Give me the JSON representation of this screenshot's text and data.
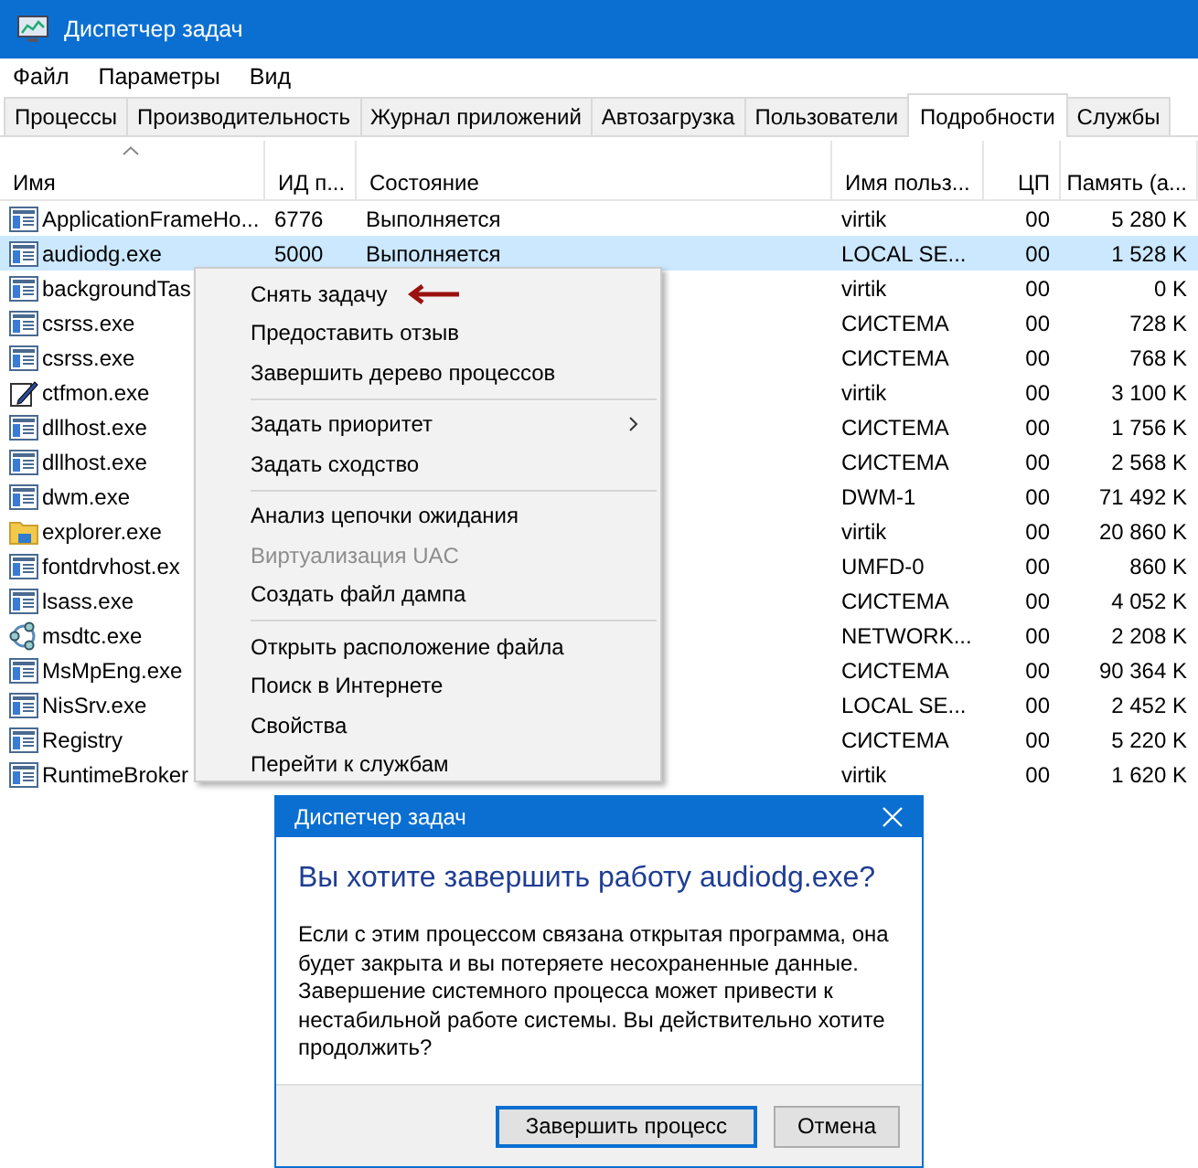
{
  "window": {
    "title": "Диспетчер задач"
  },
  "menu_bar": [
    "Файл",
    "Параметры",
    "Вид"
  ],
  "tabs": [
    {
      "label": "Процессы",
      "selected": false
    },
    {
      "label": "Производительность",
      "selected": false
    },
    {
      "label": "Журнал приложений",
      "selected": false
    },
    {
      "label": "Автозагрузка",
      "selected": false
    },
    {
      "label": "Пользователи",
      "selected": false
    },
    {
      "label": "Подробности",
      "selected": true
    },
    {
      "label": "Службы",
      "selected": false
    }
  ],
  "table": {
    "columns": [
      {
        "label": "Имя",
        "sorted": true
      },
      {
        "label": "ИД п...",
        "sorted": false
      },
      {
        "label": "Состояние",
        "sorted": false
      },
      {
        "label": "Имя польз...",
        "sorted": false
      },
      {
        "label": "ЦП",
        "sorted": false
      },
      {
        "label": "Память (а...",
        "sorted": false
      }
    ],
    "rows": [
      {
        "kind": "window",
        "name": "ApplicationFrameHo...",
        "pid": "6776",
        "state": "Выполняется",
        "user": "virtik",
        "cpu": "00",
        "memory": "5 280 K",
        "selected": false
      },
      {
        "kind": "window",
        "name": "audiodg.exe",
        "pid": "5000",
        "state": "Выполняется",
        "user": "LOCAL SE...",
        "cpu": "00",
        "memory": "1 528 K",
        "selected": true
      },
      {
        "kind": "window",
        "name": "backgroundTas",
        "user": "virtik",
        "cpu": "00",
        "memory": "0 K",
        "selected": false
      },
      {
        "kind": "window",
        "name": "csrss.exe",
        "user": "СИСТЕМА",
        "cpu": "00",
        "memory": "728 K",
        "selected": false
      },
      {
        "kind": "window",
        "name": "csrss.exe",
        "user": "СИСТЕМА",
        "cpu": "00",
        "memory": "768 K",
        "selected": false
      },
      {
        "kind": "pen",
        "name": "ctfmon.exe",
        "user": "virtik",
        "cpu": "00",
        "memory": "3 100 K",
        "selected": false
      },
      {
        "kind": "window",
        "name": "dllhost.exe",
        "user": "СИСТЕМА",
        "cpu": "00",
        "memory": "1 756 K",
        "selected": false
      },
      {
        "kind": "window",
        "name": "dllhost.exe",
        "user": "СИСТЕМА",
        "cpu": "00",
        "memory": "2 568 K",
        "selected": false
      },
      {
        "kind": "window",
        "name": "dwm.exe",
        "user": "DWM-1",
        "cpu": "00",
        "memory": "71 492 K",
        "selected": false
      },
      {
        "kind": "folder",
        "name": "explorer.exe",
        "user": "virtik",
        "cpu": "00",
        "memory": "20 860 K",
        "selected": false
      },
      {
        "kind": "window",
        "name": "fontdrvhost.ex",
        "user": "UMFD-0",
        "cpu": "00",
        "memory": "860 K",
        "selected": false
      },
      {
        "kind": "window",
        "name": "lsass.exe",
        "user": "СИСТЕМА",
        "cpu": "00",
        "memory": "4 052 K",
        "selected": false
      },
      {
        "kind": "network",
        "name": "msdtc.exe",
        "user": "NETWORK...",
        "cpu": "00",
        "memory": "2 208 K",
        "selected": false
      },
      {
        "kind": "window",
        "name": "MsMpEng.exe",
        "user": "СИСТЕМА",
        "cpu": "00",
        "memory": "90 364 K",
        "selected": false
      },
      {
        "kind": "window",
        "name": "NisSrv.exe",
        "user": "LOCAL SE...",
        "cpu": "00",
        "memory": "2 452 K",
        "selected": false
      },
      {
        "kind": "window",
        "name": "Registry",
        "user": "СИСТЕМА",
        "cpu": "00",
        "memory": "5 220 K",
        "selected": false
      },
      {
        "kind": "window",
        "name": "RuntimeBroker",
        "user": "virtik",
        "cpu": "00",
        "memory": "1 620 K",
        "selected": false
      }
    ]
  },
  "context_menu": {
    "items": [
      {
        "kind": "item",
        "label": "Снять задачу",
        "disabled": false,
        "submenu": false,
        "annotated": true
      },
      {
        "kind": "item",
        "label": "Предоставить отзыв",
        "disabled": false,
        "submenu": false,
        "annotated": false
      },
      {
        "kind": "item",
        "label": "Завершить дерево процессов",
        "disabled": false,
        "submenu": false,
        "annotated": false
      },
      {
        "kind": "separator"
      },
      {
        "kind": "item",
        "label": "Задать приоритет",
        "disabled": false,
        "submenu": true,
        "annotated": false
      },
      {
        "kind": "item",
        "label": "Задать сходство",
        "disabled": false,
        "submenu": false,
        "annotated": false
      },
      {
        "kind": "separator"
      },
      {
        "kind": "item",
        "label": "Анализ цепочки ожидания",
        "disabled": false,
        "submenu": false,
        "annotated": false
      },
      {
        "kind": "item",
        "label": "Виртуализация UAC",
        "disabled": true,
        "submenu": false,
        "annotated": false
      },
      {
        "kind": "item",
        "label": "Создать файл дампа",
        "disabled": false,
        "submenu": false,
        "annotated": false
      },
      {
        "kind": "separator"
      },
      {
        "kind": "item",
        "label": "Открыть расположение файла",
        "disabled": false,
        "submenu": false,
        "annotated": false
      },
      {
        "kind": "item",
        "label": "Поиск в Интернете",
        "disabled": false,
        "submenu": false,
        "annotated": false
      },
      {
        "kind": "item",
        "label": "Свойства",
        "disabled": false,
        "submenu": false,
        "annotated": false
      },
      {
        "kind": "item",
        "label": "Перейти к службам",
        "disabled": false,
        "submenu": false,
        "annotated": false
      }
    ]
  },
  "dialog": {
    "title": "Диспетчер задач",
    "heading": "Вы хотите завершить работу audiodg.exe?",
    "message": "Если с  этим процессом связана открытая программа, она будет закрыта и вы потеряете несохраненные данные. Завершение системного процесса может привести к нестабильной работе системы. Вы действительно хотите продолжить?",
    "buttons": [
      {
        "label": "Завершить процесс",
        "default": true
      },
      {
        "label": "Отмена",
        "default": false
      }
    ]
  }
}
